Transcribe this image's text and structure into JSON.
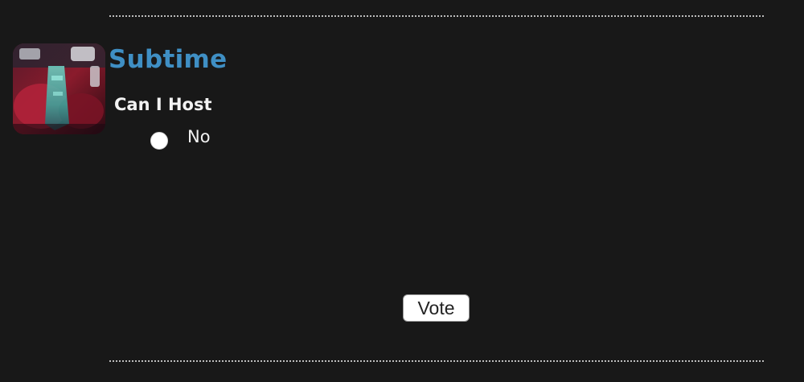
{
  "poll": {
    "title": "Subtime",
    "question": "Can I Host",
    "options": [
      {
        "label": "No",
        "selected": false
      }
    ],
    "vote_label": "Vote",
    "thumbnail_icon": "photo-thumbnail",
    "title_color": "#3f8fc4"
  }
}
